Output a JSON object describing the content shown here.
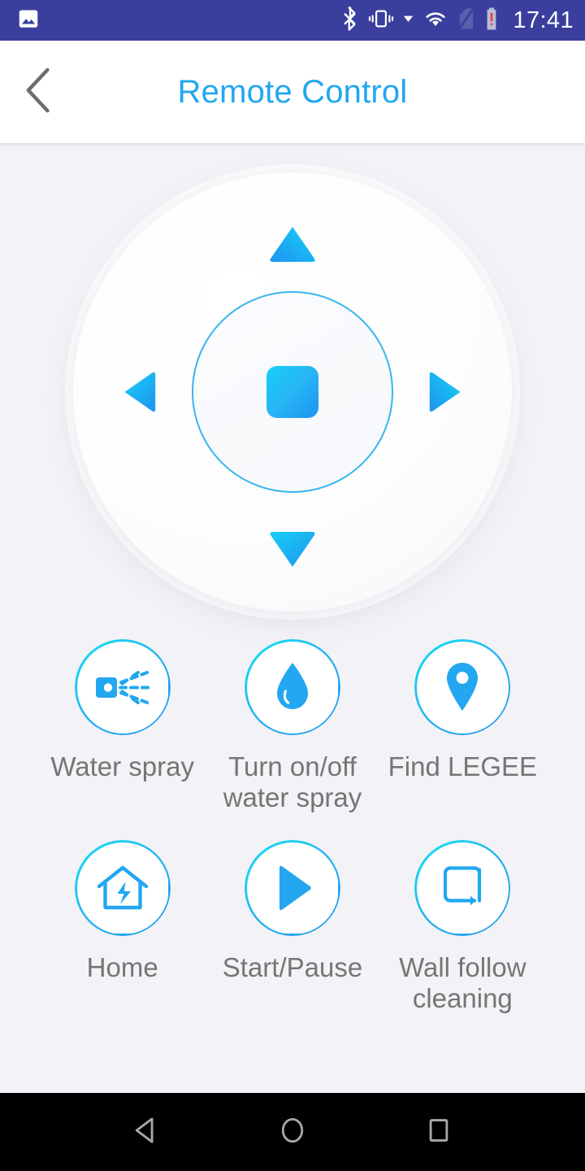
{
  "statusbar": {
    "time": "17:41",
    "background": "#3a3f9e",
    "icons": [
      {
        "name": "photo-icon",
        "side": "left"
      },
      {
        "name": "bluetooth-icon",
        "side": "right"
      },
      {
        "name": "vibrate-icon",
        "side": "right"
      },
      {
        "name": "wifi-icon",
        "side": "right"
      },
      {
        "name": "no-sim-icon",
        "side": "right"
      },
      {
        "name": "battery-alert-icon",
        "side": "right"
      }
    ]
  },
  "appbar": {
    "title": "Remote Control",
    "title_color": "#22a7f0",
    "back_icon": "chevron-left-icon"
  },
  "dpad": {
    "up": {
      "name": "dpad-up-button",
      "icon": "triangle-up-icon"
    },
    "down": {
      "name": "dpad-down-button",
      "icon": "triangle-down-icon"
    },
    "left": {
      "name": "dpad-left-button",
      "icon": "triangle-left-icon"
    },
    "right": {
      "name": "dpad-right-button",
      "icon": "triangle-right-icon"
    },
    "stop": {
      "name": "stop-button",
      "icon": "square-stop-icon"
    },
    "accent_start": "#18d0f5",
    "accent_end": "#1e93f0"
  },
  "actions": [
    {
      "id": "water-spray",
      "icon": "spray-nozzle-icon",
      "label": "Water spray"
    },
    {
      "id": "toggle-water-spray",
      "icon": "water-drop-icon",
      "label": "Turn on/off\nwater spray"
    },
    {
      "id": "find-legee",
      "icon": "map-pin-icon",
      "label": "Find LEGEE"
    },
    {
      "id": "home",
      "icon": "house-charge-icon",
      "label": "Home"
    },
    {
      "id": "start-pause",
      "icon": "play-icon",
      "label": "Start/Pause"
    },
    {
      "id": "wall-follow",
      "icon": "wall-follow-icon",
      "label": "Wall follow\ncleaning"
    }
  ],
  "navbar": {
    "background": "#000000",
    "back_label": "Back",
    "home_label": "Home",
    "recents_label": "Recents"
  },
  "colors": {
    "page_bg": "#f3f2f6",
    "accent": "#22a7f0",
    "label_text": "#757575"
  }
}
